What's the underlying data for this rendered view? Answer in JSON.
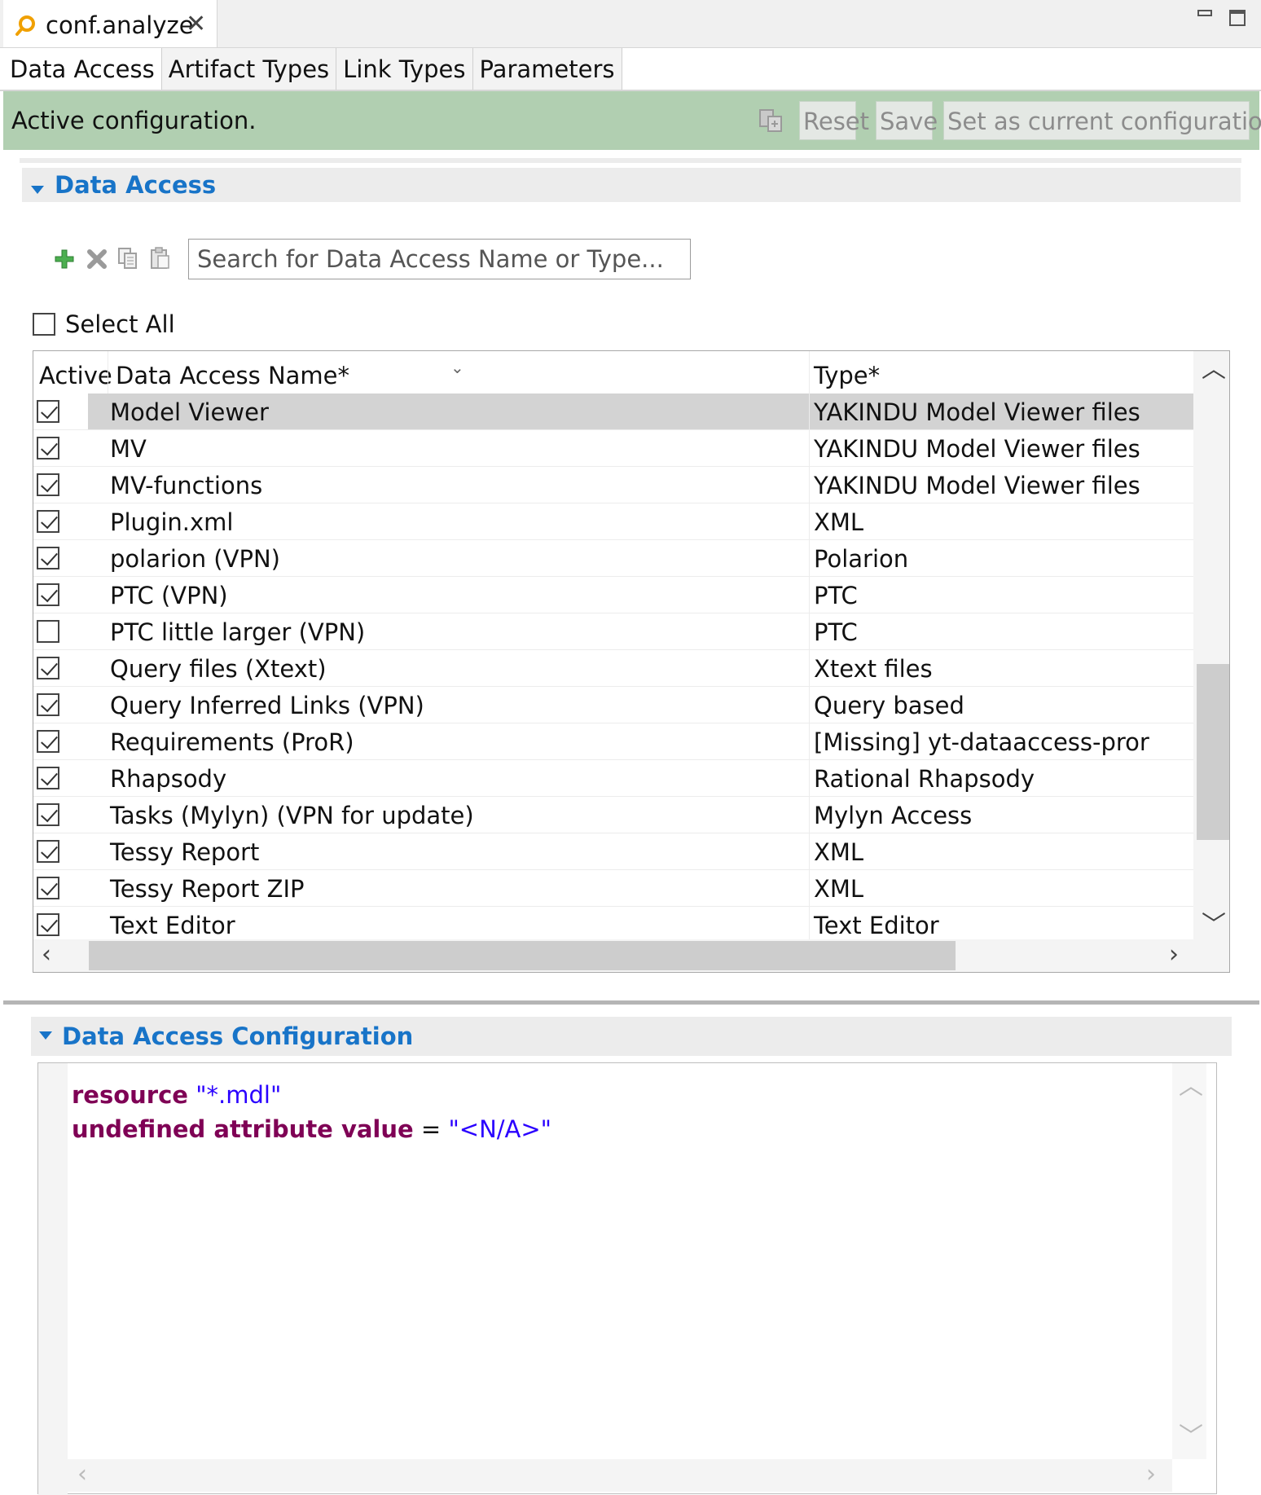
{
  "editor": {
    "tab_title": "conf.analyze"
  },
  "page_tabs": [
    {
      "label": "Data Access",
      "active": true
    },
    {
      "label": "Artifact Types"
    },
    {
      "label": "Link Types"
    },
    {
      "label": "Parameters"
    }
  ],
  "status": {
    "text": "Active configuration.",
    "reset_label": "Reset",
    "save_label": "Save",
    "set_current_label": "Set as current configuration"
  },
  "data_access": {
    "title": "Data Access",
    "search_placeholder": "Search for Data Access Name or Type...",
    "select_all_label": "Select All",
    "columns": {
      "active": "Active",
      "name": "Data Access Name*",
      "type": "Type*"
    },
    "rows": [
      {
        "active": true,
        "name": "Model Viewer",
        "type": "YAKINDU Model Viewer files",
        "selected": true
      },
      {
        "active": true,
        "name": "MV",
        "type": "YAKINDU Model Viewer files"
      },
      {
        "active": true,
        "name": "MV-functions",
        "type": "YAKINDU Model Viewer files"
      },
      {
        "active": true,
        "name": "Plugin.xml",
        "type": "XML"
      },
      {
        "active": true,
        "name": "polarion (VPN)",
        "type": "Polarion"
      },
      {
        "active": true,
        "name": "PTC (VPN)",
        "type": "PTC"
      },
      {
        "active": false,
        "name": "PTC little larger (VPN)",
        "type": "PTC"
      },
      {
        "active": true,
        "name": "Query files (Xtext)",
        "type": "Xtext files"
      },
      {
        "active": true,
        "name": "Query Inferred Links (VPN)",
        "type": "Query based"
      },
      {
        "active": true,
        "name": "Requirements (ProR)",
        "type": "[Missing] yt-dataaccess-pror"
      },
      {
        "active": true,
        "name": "Rhapsody",
        "type": "Rational Rhapsody"
      },
      {
        "active": true,
        "name": "Tasks (Mylyn) (VPN for update)",
        "type": "Mylyn Access"
      },
      {
        "active": true,
        "name": "Tessy Report",
        "type": "XML"
      },
      {
        "active": true,
        "name": "Tessy Report ZIP",
        "type": "XML"
      },
      {
        "active": true,
        "name": "Text Editor",
        "type": "Text Editor"
      }
    ]
  },
  "configuration": {
    "title": "Data Access Configuration",
    "line1": {
      "keyword": "resource",
      "value": "\"*.mdl\""
    },
    "line2": {
      "keyword": "undefined attribute value",
      "operator": "=",
      "value": "\"<N/A>\""
    }
  },
  "icons": {
    "editor": "config-file-icon",
    "add": "add-icon",
    "remove": "delete-icon",
    "copy": "copy-icon",
    "paste": "paste-icon",
    "status": "apply-config-icon"
  },
  "colors": {
    "status_bar": "#b1cfb1",
    "section_title": "#1874c8",
    "keyword": "#7f0055",
    "string": "#2a00ff",
    "selection": "#d3d3d3"
  }
}
